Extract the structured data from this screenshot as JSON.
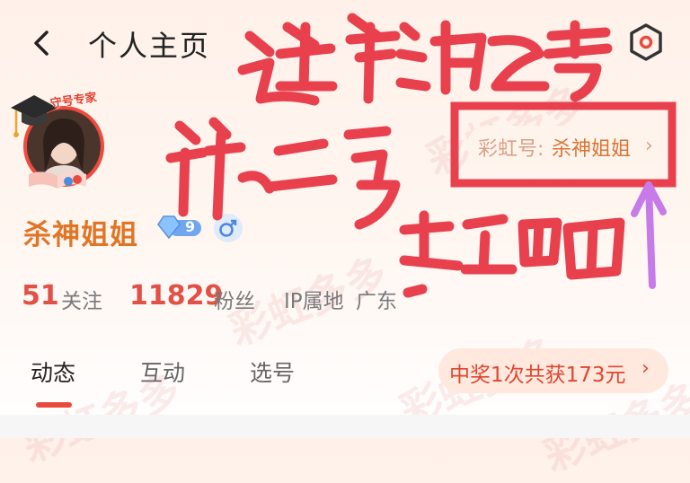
{
  "header": {
    "title": "个人主页",
    "back_icon": "chevron-left-icon",
    "settings_icon": "hexagon-settings-icon"
  },
  "profile": {
    "avatar_badge": "守号专家",
    "name": "杀神姐姐",
    "level": "9",
    "gender_icon": "male-icon",
    "rainbow_label": "彩虹号:",
    "rainbow_value": "杀神姐姐",
    "chevron": "›"
  },
  "stats": {
    "following_count": "51",
    "following_label": "关注",
    "followers_count": "11829",
    "followers_label": "粉丝",
    "ip_label": "IP属地",
    "ip_value": "广东"
  },
  "tabs": [
    {
      "label": "动态",
      "active": true
    },
    {
      "label": "互动",
      "active": false
    },
    {
      "label": "选号",
      "active": false
    }
  ],
  "prize": {
    "text": "中奖1次共获173元",
    "chevron": "›"
  },
  "annotation": {
    "handwritten": "进彩虹号 第二步 点这里",
    "color": "#e8414d",
    "arrow_color": "#c77be8"
  },
  "watermark": "彩虹多多",
  "colors": {
    "accent": "#e94a3c",
    "name": "#e07526"
  }
}
